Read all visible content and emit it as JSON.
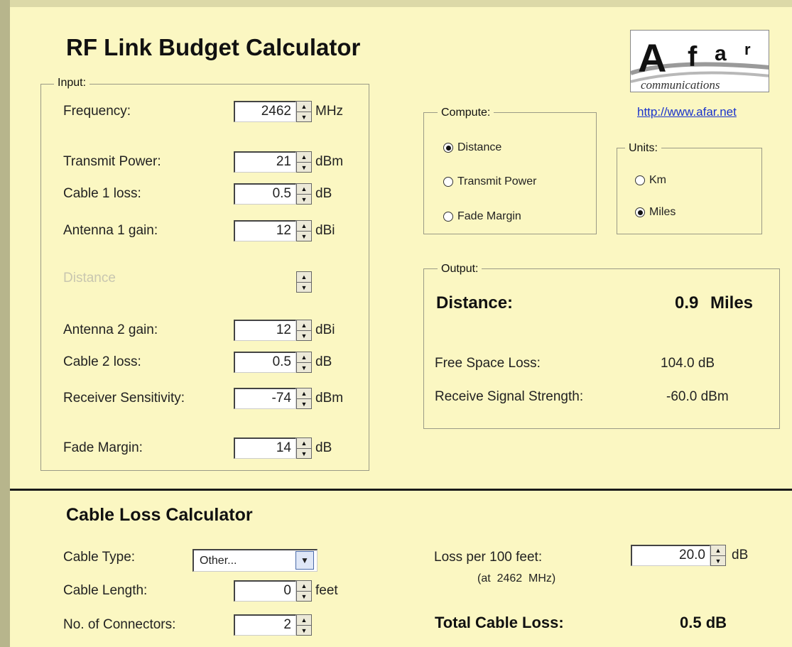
{
  "title": "RF Link Budget Calculator",
  "logo": {
    "text": "Afar",
    "sub": "communications"
  },
  "link": "http://www.afar.net",
  "input_group": {
    "legend": "Input:",
    "fields": [
      {
        "label": "Frequency:",
        "value": "2462",
        "unit": "MHz",
        "enabled": true
      },
      {
        "label": "Transmit Power:",
        "value": "21",
        "unit": "dBm",
        "enabled": true
      },
      {
        "label": "Cable 1 loss:",
        "value": "0.5",
        "unit": "dB",
        "enabled": true
      },
      {
        "label": "Antenna 1 gain:",
        "value": "12",
        "unit": "dBi",
        "enabled": true
      },
      {
        "label": "Distance",
        "value": "",
        "unit": "",
        "enabled": false
      },
      {
        "label": "Antenna 2 gain:",
        "value": "12",
        "unit": "dBi",
        "enabled": true
      },
      {
        "label": "Cable 2 loss:",
        "value": "0.5",
        "unit": "dB",
        "enabled": true
      },
      {
        "label": "Receiver Sensitivity:",
        "value": "-74",
        "unit": "dBm",
        "enabled": true
      },
      {
        "label": "Fade Margin:",
        "value": "14",
        "unit": "dB",
        "enabled": true
      }
    ]
  },
  "compute_group": {
    "legend": "Compute:",
    "options": [
      {
        "label": "Distance",
        "checked": true
      },
      {
        "label": "Transmit Power",
        "checked": false
      },
      {
        "label": "Fade Margin",
        "checked": false
      }
    ]
  },
  "units_group": {
    "legend": "Units:",
    "options": [
      {
        "label": "Km",
        "checked": false
      },
      {
        "label": "Miles",
        "checked": true
      }
    ]
  },
  "output_group": {
    "legend": "Output:",
    "result_label": "Distance:",
    "result_value": "0.9",
    "result_unit": "Miles",
    "free_space_label": "Free Space Loss:",
    "free_space_value": "104.0 dB",
    "rss_label": "Receive Signal Strength:",
    "rss_value": "-60.0 dBm"
  },
  "cable_section": {
    "title": "Cable Loss Calculator",
    "cable_type_label": "Cable Type:",
    "cable_type_value": "Other...",
    "cable_length_label": "Cable Length:",
    "cable_length_value": "0",
    "cable_length_unit": "feet",
    "connectors_label": "No. of Connectors:",
    "connectors_value": "2",
    "loss_label": "Loss per 100 feet:",
    "loss_sub": "(at  2462  MHz)",
    "loss_value": "20.0",
    "loss_unit": "dB",
    "total_label": "Total Cable Loss:",
    "total_value": "0.5 dB"
  }
}
